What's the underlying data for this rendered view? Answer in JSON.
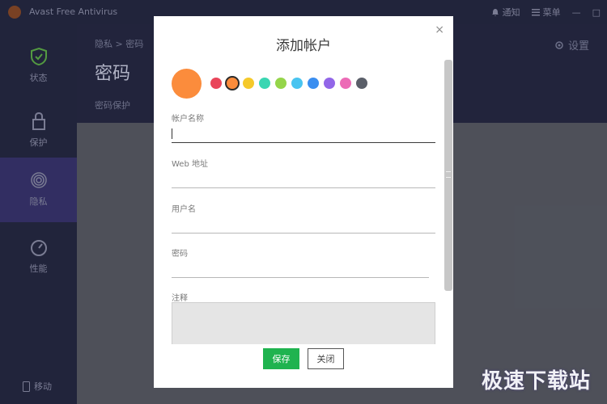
{
  "titlebar": {
    "app_title": "Avast Free Antivirus",
    "notifications": "通知",
    "menu": "菜单",
    "window_controls": [
      "—",
      "□"
    ]
  },
  "sidebar": {
    "items": [
      {
        "label": "状态",
        "icon": "shield-check-icon"
      },
      {
        "label": "保护",
        "icon": "lock-icon"
      },
      {
        "label": "隐私",
        "icon": "fingerprint-icon",
        "active": true
      },
      {
        "label": "性能",
        "icon": "speedometer-icon"
      }
    ],
    "bottom_label": "移动"
  },
  "main": {
    "breadcrumb": "隐私 > 密码",
    "title": "密码",
    "subtitle": "密码保护",
    "settings_label": "设置"
  },
  "dialog": {
    "title": "添加帐户",
    "close_symbol": "×",
    "avatar_color": "#fb8c3c",
    "colors": [
      "#e9455a",
      "#fb8c3c",
      "#f5c92a",
      "#3ad6b2",
      "#95d54a",
      "#49c4f0",
      "#3a8ef0",
      "#9266e8",
      "#ec6bb6",
      "#5b5f69"
    ],
    "selected_color_index": 1,
    "fields": {
      "account_name": {
        "label": "帐户名称",
        "value": ""
      },
      "web_address": {
        "label": "Web 地址",
        "value": ""
      },
      "username": {
        "label": "用户名",
        "value": ""
      },
      "password": {
        "label": "密码",
        "value": ""
      },
      "notes": {
        "label": "注释",
        "value": ""
      }
    },
    "save_label": "保存",
    "close_label": "关闭"
  },
  "watermark": "极速下载站"
}
